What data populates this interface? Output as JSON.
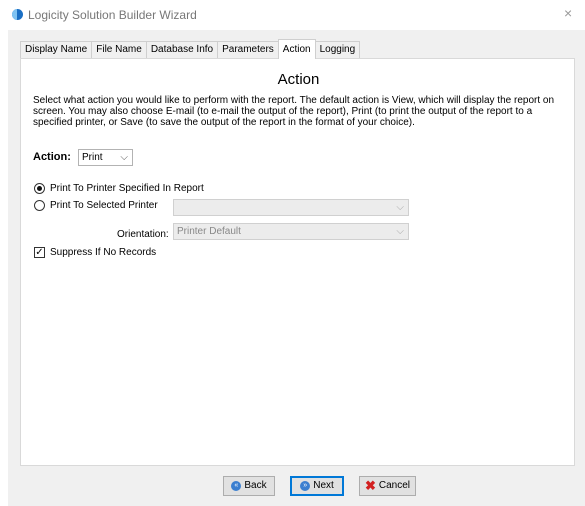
{
  "window": {
    "title": "Logicity Solution Builder Wizard",
    "close_glyph": "×",
    "app_icon": "logicity-app-icon"
  },
  "tabs": [
    {
      "label": "Display Name",
      "active": false
    },
    {
      "label": "File Name",
      "active": false
    },
    {
      "label": "Database Info",
      "active": false
    },
    {
      "label": "Parameters",
      "active": false
    },
    {
      "label": "Action",
      "active": true
    },
    {
      "label": "Logging",
      "active": false
    }
  ],
  "panel": {
    "heading": "Action",
    "description": "Select what action you would like to perform with the report.  The default action is View, which will display the report on screen.  You may also choose E-mail (to e-mail the output of the report), Print (to print the output of the report to a specified printer, or Save (to save the output of the report in the format of your choice).",
    "action_label": "Action:",
    "action_value": "Print",
    "radio_report_printer": {
      "label": "Print To Printer Specified In Report",
      "checked": true
    },
    "radio_selected_printer": {
      "label": "Print To Selected Printer",
      "checked": false
    },
    "printer_value": "",
    "orientation_label": "Orientation:",
    "orientation_value": "Printer Default",
    "suppress": {
      "label": "Suppress If No Records",
      "checked": true
    }
  },
  "buttons": {
    "back": "Back",
    "next": "Next",
    "cancel": "Cancel",
    "chevron_glyph": "⌵",
    "back_glyph": "«",
    "next_glyph": "»",
    "cancel_glyph": "✖",
    "check_glyph": "✓"
  }
}
